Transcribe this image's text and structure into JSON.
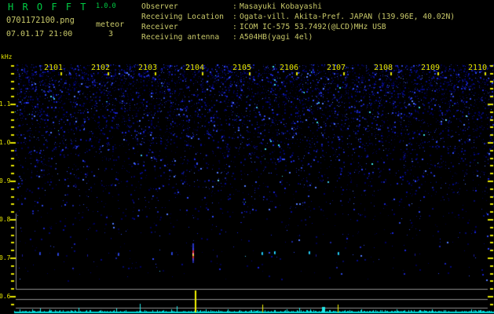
{
  "app": {
    "title": "H R O F F T",
    "version": "1.0.0"
  },
  "capture": {
    "filename": "0701172100.png",
    "mode": "meteor",
    "meteor_count": "3",
    "datetime": "07.01.17 21:00"
  },
  "station": {
    "rows": [
      {
        "label": "Observer",
        "sep": ":",
        "value": "Masayuki Kobayashi"
      },
      {
        "label": "Receiving Location",
        "sep": ":",
        "value": "Ogata-vill. Akita-Pref. JAPAN (139.96E, 40.02N)"
      },
      {
        "label": "Receiver",
        "sep": ":",
        "value": "ICOM IC-575 53.7492(@LCD)MHz USB"
      },
      {
        "label": "Receiving antenna",
        "sep": ":",
        "value": "A504HB(yagi 4el)"
      }
    ]
  },
  "colors": {
    "title_green": "#00cc44",
    "header_yellow": "#c9c96a",
    "axis_yellow": "#e6e600",
    "grid_grey": "#8e8e8e",
    "baseline_cyan": "#00dcdc",
    "spike_cyan": "#22e8e8",
    "spike_yellow": "#f4f400",
    "echo_strong_core": "#ffd23e"
  },
  "chart_data": {
    "type": "heatmap",
    "title": "HROFFT radio meteor echo spectrogram, 21:00-21:10",
    "ylabel": "kHz",
    "freq_tick_labels": [
      "1.1",
      "1.0",
      "0.9",
      "0.8",
      "0.7",
      "0.6"
    ],
    "freq_major_step_khz": 0.1,
    "freq_minor_step_khz": 0.02,
    "time_tick_labels": [
      "2101",
      "2102",
      "2103",
      "2104",
      "2105",
      "2106",
      "2107",
      "2108",
      "2109",
      "2110"
    ],
    "time_span_min": 10,
    "echo_band_khz": 0.71,
    "echoes": [
      {
        "t": 0.17,
        "f": 0.708,
        "i": "faint"
      },
      {
        "t": 0.53,
        "f": 0.712,
        "i": "medium"
      },
      {
        "t": 0.92,
        "f": 0.71,
        "i": "medium"
      },
      {
        "t": 1.55,
        "f": 0.708,
        "i": "faint"
      },
      {
        "t": 2.2,
        "f": 0.71,
        "i": "medium"
      },
      {
        "t": 3.33,
        "f": 0.712,
        "i": "medium"
      },
      {
        "t": 3.8,
        "f": 0.705,
        "i": "strong"
      },
      {
        "t": 4.3,
        "f": 0.706,
        "i": "faint"
      },
      {
        "t": 5.25,
        "f": 0.712,
        "i": "bright"
      },
      {
        "t": 5.52,
        "f": 0.714,
        "i": "bright"
      },
      {
        "t": 6.25,
        "f": 0.714,
        "i": "bright"
      },
      {
        "t": 6.4,
        "f": 0.708,
        "i": "faint"
      },
      {
        "t": 6.87,
        "f": 0.712,
        "i": "bright"
      },
      {
        "t": 8.5,
        "f": 0.71,
        "i": "faint"
      },
      {
        "t": 9.75,
        "f": 0.708,
        "i": "faint"
      }
    ],
    "bright_specks": [
      {
        "t": 4.32,
        "f": 0.904
      },
      {
        "t": 9.15,
        "f": 1.061
      },
      {
        "t": 9.58,
        "f": 1.071
      }
    ],
    "signal_level_spikes": [
      {
        "t": 0.12,
        "h": 4,
        "c": "cyan"
      },
      {
        "t": 0.38,
        "h": 4,
        "c": "cyan"
      },
      {
        "t": 0.55,
        "h": 5,
        "c": "cyan"
      },
      {
        "t": 0.75,
        "h": 4,
        "c": "cyan"
      },
      {
        "t": 0.87,
        "h": 3,
        "c": "cyan"
      },
      {
        "t": 1.2,
        "h": 3,
        "c": "cyan"
      },
      {
        "t": 1.37,
        "h": 6,
        "c": "cyan"
      },
      {
        "t": 1.83,
        "h": 3,
        "c": "cyan"
      },
      {
        "t": 2.17,
        "h": 5,
        "c": "cyan"
      },
      {
        "t": 2.67,
        "h": 11,
        "c": "cyan"
      },
      {
        "t": 3.03,
        "h": 3,
        "c": "cyan"
      },
      {
        "t": 3.33,
        "h": 4,
        "c": "cyan"
      },
      {
        "t": 3.45,
        "h": 8,
        "c": "cyan"
      },
      {
        "t": 3.83,
        "h": 28,
        "c": "yellow",
        "w": 2
      },
      {
        "t": 4.07,
        "h": 4,
        "c": "cyan"
      },
      {
        "t": 4.33,
        "h": 3,
        "c": "cyan"
      },
      {
        "t": 4.53,
        "h": 4,
        "c": "cyan"
      },
      {
        "t": 4.78,
        "h": 3,
        "c": "cyan"
      },
      {
        "t": 5.03,
        "h": 3,
        "c": "cyan"
      },
      {
        "t": 5.27,
        "h": 10,
        "c": "yellow"
      },
      {
        "t": 5.53,
        "h": 3,
        "c": "cyan"
      },
      {
        "t": 5.78,
        "h": 4,
        "c": "cyan"
      },
      {
        "t": 6.05,
        "h": 6,
        "c": "cyan"
      },
      {
        "t": 6.28,
        "h": 4,
        "c": "cyan"
      },
      {
        "t": 6.53,
        "h": 7,
        "c": "cyan",
        "w": 4
      },
      {
        "t": 6.7,
        "h": 3,
        "c": "cyan"
      },
      {
        "t": 6.87,
        "h": 10,
        "c": "yellow"
      },
      {
        "t": 7.12,
        "h": 3,
        "c": "cyan"
      },
      {
        "t": 7.37,
        "h": 4,
        "c": "cyan"
      },
      {
        "t": 7.62,
        "h": 3,
        "c": "cyan"
      },
      {
        "t": 7.87,
        "h": 3,
        "c": "cyan"
      },
      {
        "t": 8.12,
        "h": 4,
        "c": "cyan"
      },
      {
        "t": 8.37,
        "h": 3,
        "c": "cyan"
      },
      {
        "t": 8.62,
        "h": 3,
        "c": "cyan"
      },
      {
        "t": 8.87,
        "h": 4,
        "c": "cyan"
      },
      {
        "t": 9.12,
        "h": 3,
        "c": "cyan"
      },
      {
        "t": 9.37,
        "h": 3,
        "c": "cyan"
      },
      {
        "t": 9.7,
        "h": 4,
        "c": "cyan"
      },
      {
        "t": 9.9,
        "h": 3,
        "c": "cyan"
      }
    ]
  }
}
